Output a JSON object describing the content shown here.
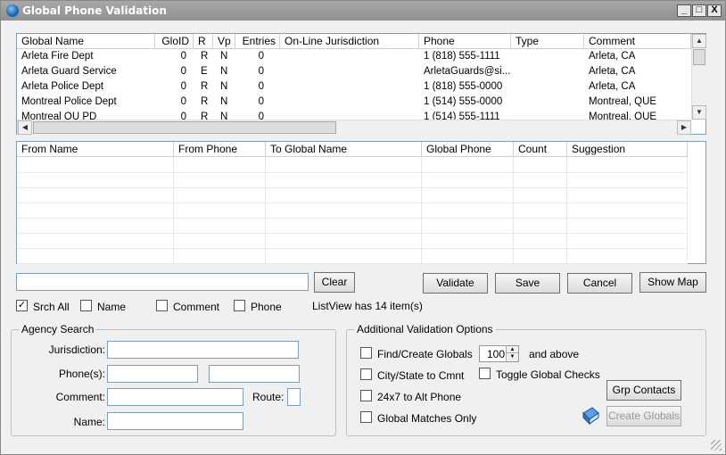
{
  "window": {
    "title": "Global Phone Validation",
    "minimize": "_",
    "maximize": "□",
    "close": "X"
  },
  "top_list": {
    "columns": [
      "Global Name",
      "GloID",
      "R",
      "Vp",
      "Entries",
      "On-Line Jurisdiction",
      "Phone",
      "Type",
      "Comment"
    ],
    "rows": [
      [
        "Arleta Fire Dept",
        "0",
        "R",
        "N",
        "0",
        "",
        "1 (818) 555-1111",
        "",
        "Arleta, CA"
      ],
      [
        "Arleta Guard Service",
        "0",
        "E",
        "N",
        "0",
        "",
        "ArletaGuards@si...",
        "",
        "Arleta, CA"
      ],
      [
        "Arleta Police Dept",
        "0",
        "R",
        "N",
        "0",
        "",
        "1 (818) 555-0000",
        "",
        "Arleta, CA"
      ],
      [
        "Montreal Police Dept",
        "0",
        "R",
        "N",
        "0",
        "",
        "1 (514) 555-0000",
        "",
        "Montreal, QUE"
      ],
      [
        "Montreal QU PD",
        "0",
        "R",
        "N",
        "0",
        "",
        "1 (514) 555-1111",
        "",
        "Montreal, QUE"
      ]
    ]
  },
  "bottom_list": {
    "columns": [
      "From Name",
      "From Phone",
      "To Global Name",
      "Global Phone",
      "Count",
      "Suggestion"
    ]
  },
  "search": {
    "value": "",
    "clear_label": "Clear"
  },
  "buttons": {
    "validate": "Validate",
    "save": "Save",
    "cancel": "Cancel",
    "show_map": "Show Map",
    "grp_contacts": "Grp Contacts",
    "create_globals": "Create Globals"
  },
  "filters": {
    "srch_all": "Srch All",
    "name": "Name",
    "comment": "Comment",
    "phone": "Phone"
  },
  "status_text": "ListView has 14 item(s)",
  "agency_search": {
    "title": "Agency Search",
    "jurisdiction_label": "Jurisdiction:",
    "phones_label": "Phone(s):",
    "comment_label": "Comment:",
    "route_label": "Route:",
    "name_label": "Name:"
  },
  "validation_options": {
    "title": "Additional Validation Options",
    "find_create": "Find/Create Globals",
    "count_value": "100",
    "and_above": "and above",
    "city_state": "City/State to Cmnt",
    "toggle_global": "Toggle Global Checks",
    "alt_phone": "24x7 to Alt Phone",
    "matches_only": "Global Matches Only"
  }
}
